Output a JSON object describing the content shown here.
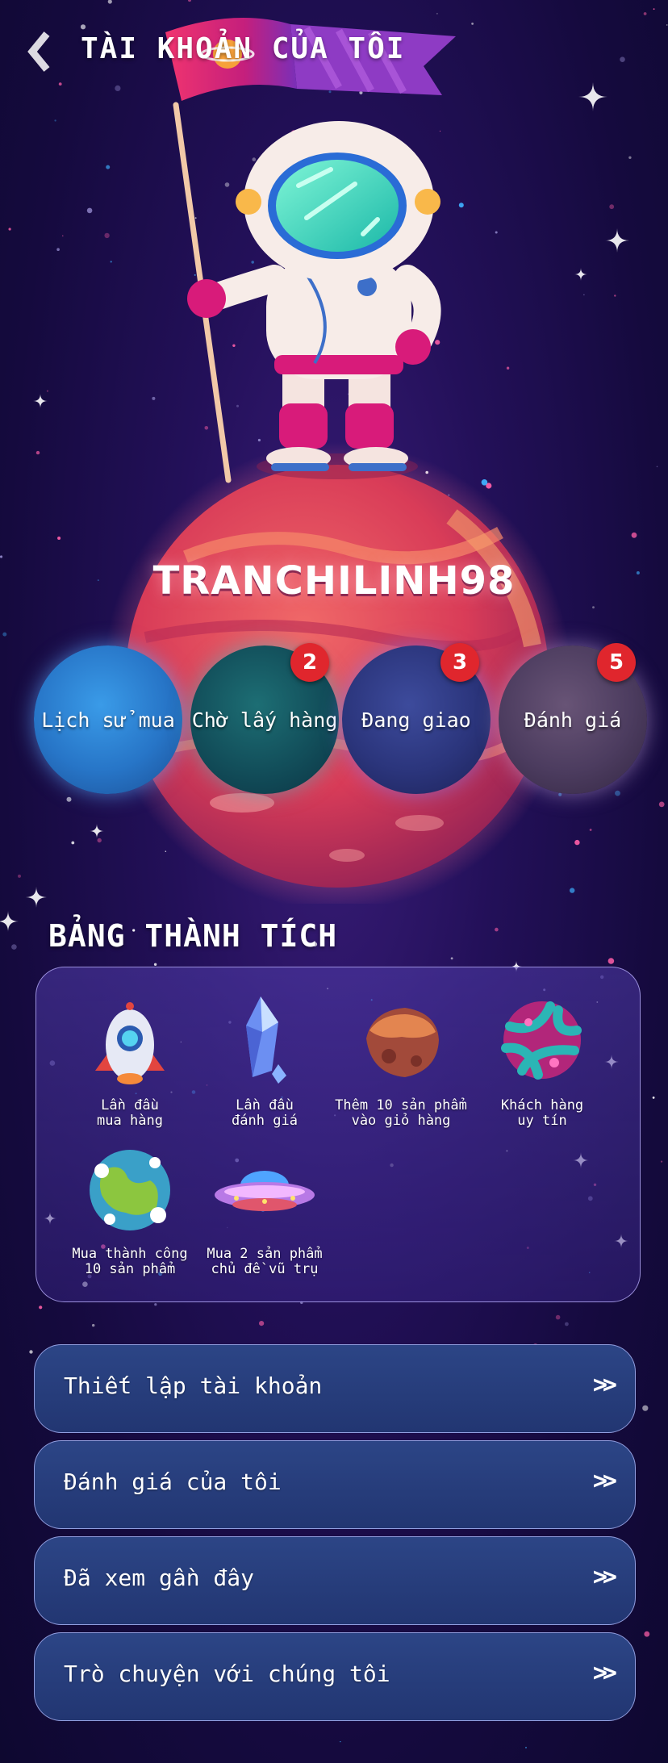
{
  "header": {
    "title": "TÀI KHOẢN CỦA TÔI",
    "back_icon": "chevron-left-icon"
  },
  "profile": {
    "username": "TRANCHILINH98"
  },
  "orders": [
    {
      "label": "Lịch sử mua",
      "badge": null,
      "color": "#2775c7"
    },
    {
      "label": "Chờ lấy hàng",
      "badge": "2",
      "color": "#124e5a"
    },
    {
      "label": "Đang giao",
      "badge": "3",
      "color": "#2b357c"
    },
    {
      "label": "Đánh giá",
      "badge": "5",
      "color": "#4c3c5f"
    }
  ],
  "achievements": {
    "title": "BẢNG THÀNH TÍCH",
    "items": [
      {
        "line1": "Lần đầu",
        "line2": "mua hàng",
        "icon": "rocket-icon"
      },
      {
        "line1": "Lần đầu",
        "line2": "đánh giá",
        "icon": "crystal-icon"
      },
      {
        "line1": "Thêm 10 sản phẩm",
        "line2": "vào giỏ hàng",
        "icon": "asteroid-icon"
      },
      {
        "line1": "Khách hàng",
        "line2": "uy tín",
        "icon": "alien-planet-icon"
      },
      {
        "line1": "Mua thành công",
        "line2": "10 sản phẩm",
        "icon": "earth-icon"
      },
      {
        "line1": "Mua 2 sản phẩm",
        "line2": "chủ đề vũ trụ",
        "icon": "ufo-icon"
      }
    ]
  },
  "menu": [
    {
      "label": "Thiết lập tài khoản",
      "chevron": "»"
    },
    {
      "label": "Đánh giá của tôi",
      "chevron": "»"
    },
    {
      "label": "Đã xem gần đây",
      "chevron": "»"
    },
    {
      "label": "Trò chuyện với chúng tôi",
      "chevron": "»"
    }
  ],
  "colors": {
    "background": "#1a0d4a",
    "planet": "#e0485f",
    "badge": "#e0262d",
    "menu": "#2c4586",
    "flag": "#e8336e"
  }
}
